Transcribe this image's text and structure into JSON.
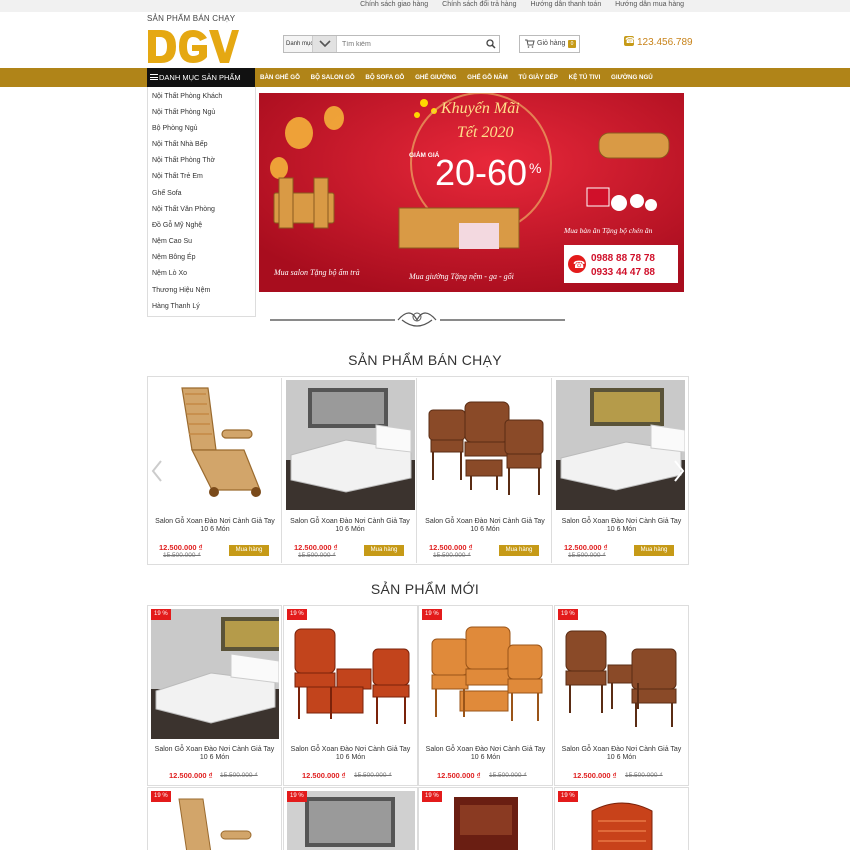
{
  "top": {
    "links": [
      "Chính sách giao hàng",
      "Chính sách đổi trả hàng",
      "Hướng dẫn thanh toán",
      "Hướng dẫn mua hàng"
    ],
    "tagline": "SẢN PHẨM BÁN CHẠY"
  },
  "header": {
    "logo": "DGV",
    "search_category": "Danh mục",
    "search_placeholder": "Tìm kiếm",
    "cart_label": "Giỏ hàng",
    "cart_count": "0",
    "phone": "123.456.789",
    "brand_color": "#c69a17"
  },
  "nav": {
    "category_button": "DANH MỤC SẢN PHẨM",
    "items": [
      "BÀN GHẾ GỖ",
      "BỘ SALON GỖ",
      "BỘ SOFA GỖ",
      "GHẾ GIƯỜNG",
      "GHẾ GỖ NĂM",
      "TỦ GIÀY DÉP",
      "KỆ TỦ TIVI",
      "GIƯỜNG NGỦ"
    ]
  },
  "sidebar": {
    "items": [
      "Nội Thất Phòng Khách",
      "Nội Thất Phòng Ngủ",
      "Bộ Phòng Ngủ",
      "Nội Thất Nhà Bếp",
      "Nội Thất Phòng Thờ",
      "Nội Thất Trẻ Em",
      "Ghế Sofa",
      "Nội Thất Văn Phòng",
      "Đồ Gỗ Mỹ Nghệ",
      "Nệm Cao Su",
      "Nệm Bông Ép",
      "Nệm Lò Xo",
      "Thương Hiệu Nệm",
      "Hàng Thanh Lý"
    ]
  },
  "banner": {
    "promo_title": "Khuyến Mãi",
    "promo_year": "Tết 2020",
    "discount_prefix": "GIẢM GIÁ",
    "discount_range": "20-60",
    "percent_sign": "%",
    "caption_left": "Mua salon Tặng bộ ấm trà",
    "caption_center": "Mua giường Tặng nệm - ga - gối",
    "caption_right": "Mua bàn ăn Tặng bộ chén ăn",
    "phone_1": "0988 88 78 78",
    "phone_2": "0933 44 47 88"
  },
  "bestsellers": {
    "title": "SẢN PHẨM BÁN CHẠY",
    "buy_label": "Mua hàng",
    "products": [
      {
        "name": "Salon Gỗ Xoan Đào Nơi Cành Giả Tay 10 6 Món",
        "price": "12.500.000 ₫",
        "old_price": "15.500.000 ₫",
        "image": "reclining-chair"
      },
      {
        "name": "Salon Gỗ Xoan Đào Nơi Cành Giả Tay 10 6 Món",
        "price": "12.500.000 ₫",
        "old_price": "15.500.000 ₫",
        "image": "white-bed"
      },
      {
        "name": "Salon Gỗ Xoan Đào Nơi Cành Giả Tay 10 6 Món",
        "price": "12.500.000 ₫",
        "old_price": "15.500.000 ₫",
        "image": "wood-salon-set"
      },
      {
        "name": "Salon Gỗ Xoan Đào Nơi Cành Giả Tay 10 6 Món",
        "price": "12.500.000 ₫",
        "old_price": "15.500.000 ₫",
        "image": "white-bed"
      }
    ]
  },
  "newproducts": {
    "title": "SẢN PHẨM MỚI",
    "products": [
      {
        "name": "Salon Gỗ Xoan Đào Nơi Cành Giả Tay 10 6 Món",
        "price": "12.500.000 ₫",
        "old_price": "15.500.000 ₫",
        "discount": "19 %",
        "image": "white-bed"
      },
      {
        "name": "Salon Gỗ Xoan Đào Nơi Cành Giả Tay 10 6 Món",
        "price": "12.500.000 ₫",
        "old_price": "15.500.000 ₫",
        "discount": "19 %",
        "image": "red-salon-set"
      },
      {
        "name": "Salon Gỗ Xoan Đào Nơi Cành Giả Tay 10 6 Món",
        "price": "12.500.000 ₫",
        "old_price": "15.500.000 ₫",
        "discount": "19 %",
        "image": "orange-salon-set"
      },
      {
        "name": "Salon Gỗ Xoan Đào Nơi Cành Giả Tay 10 6 Món",
        "price": "12.500.000 ₫",
        "old_price": "15.500.000 ₫",
        "discount": "19 %",
        "image": "wood-salon-set"
      }
    ],
    "row2": [
      {
        "discount": "19 %",
        "image": "reclining-chair"
      },
      {
        "discount": "19 %",
        "image": "white-bed"
      },
      {
        "discount": "19 %",
        "image": "altar-cabinet"
      },
      {
        "discount": "19 %",
        "image": "red-chair"
      }
    ]
  }
}
